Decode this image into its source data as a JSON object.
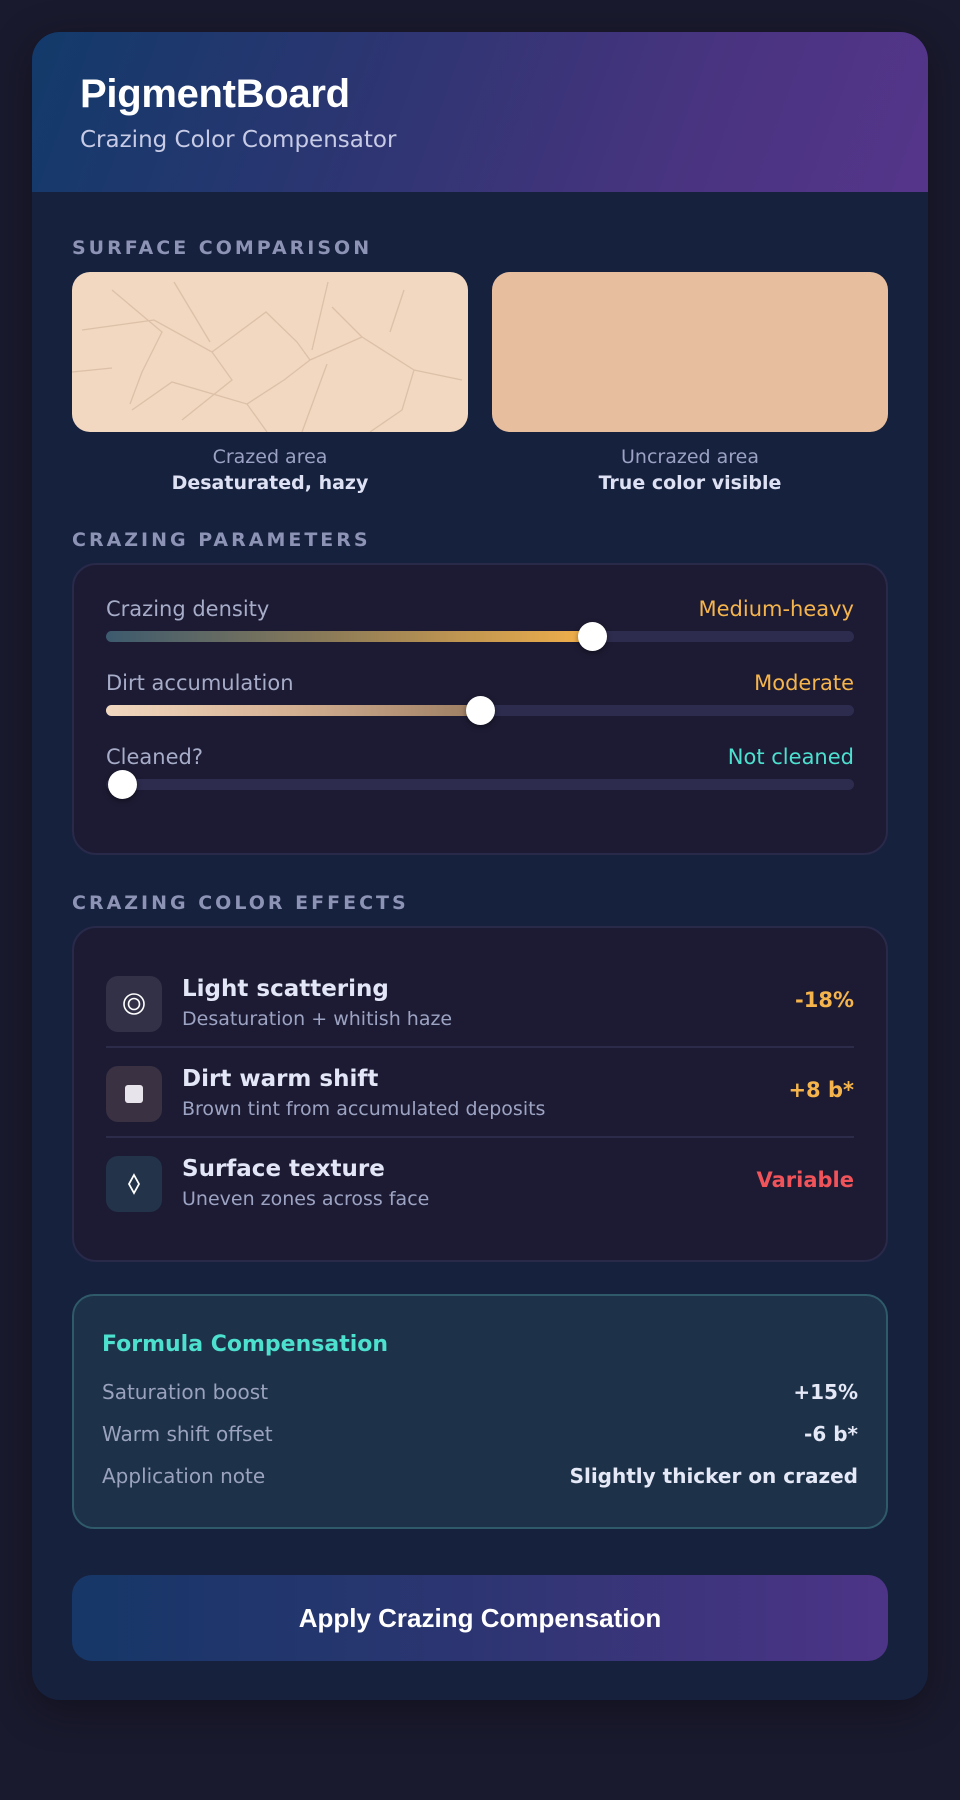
{
  "header": {
    "title": "PigmentBoard",
    "subtitle": "Crazing Color Compensator"
  },
  "surface_comparison": {
    "label": "SURFACE COMPARISON",
    "crazed": {
      "caption": "Crazed area",
      "note": "Desaturated, hazy",
      "color": "#f2d8c0"
    },
    "uncrazed": {
      "caption": "Uncrazed area",
      "note": "True color visible",
      "color": "#e8bf9e"
    }
  },
  "crazing_parameters": {
    "label": "CRAZING PARAMETERS",
    "sliders": [
      {
        "name": "Crazing density",
        "value_label": "Medium-heavy",
        "value_color": "#f6b54c",
        "level": 0.65
      },
      {
        "name": "Dirt accumulation",
        "value_label": "Moderate",
        "value_color": "#f6b54c",
        "level": 0.5
      },
      {
        "name": "Cleaned?",
        "value_label": "Not cleaned",
        "value_color": "#4de0cf",
        "level": 0.0
      }
    ]
  },
  "color_effects": {
    "label": "CRAZING COLOR EFFECTS",
    "items": [
      {
        "icon": "light-scatter-icon",
        "title": "Light scattering",
        "desc": "Desaturation + whitish haze",
        "amount": "-18%",
        "amount_color": "#f6b54c"
      },
      {
        "icon": "dirt-square-icon",
        "title": "Dirt warm shift",
        "desc": "Brown tint from accumulated deposits",
        "amount": "+8 b*",
        "amount_color": "#f6b54c"
      },
      {
        "icon": "diamond-texture-icon",
        "title": "Surface texture",
        "desc": "Uneven zones across face",
        "amount": "Variable",
        "amount_color": "#f0545a"
      }
    ]
  },
  "compensation": {
    "heading": "Formula Compensation",
    "rows": [
      {
        "key": "Saturation boost",
        "value": "+15%"
      },
      {
        "key": "Warm shift offset",
        "value": "-6 b*"
      },
      {
        "key": "Application note",
        "value": "Slightly thicker on crazed"
      }
    ]
  },
  "apply_button": {
    "label": "Apply Crazing Compensation"
  }
}
